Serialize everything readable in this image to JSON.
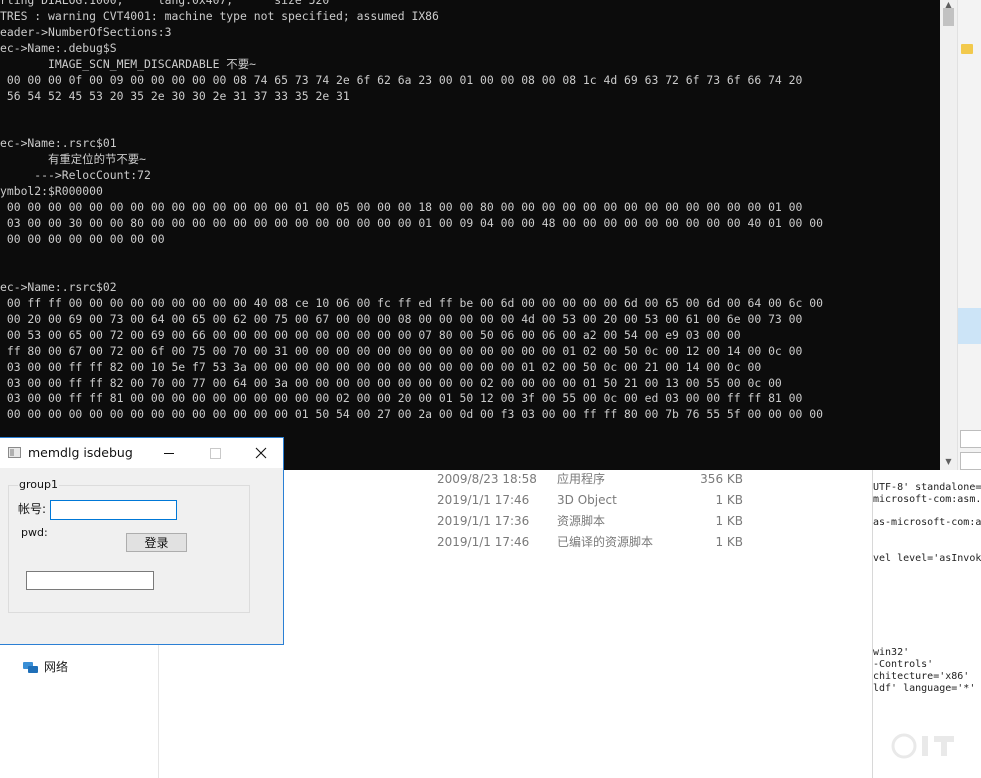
{
  "console": {
    "lines": [
      "rting DIALOG:1000,     lang:0x407,      size 520",
      "TRES : warning CVT4001: machine type not specified; assumed IX86",
      "eader->NumberOfSections:3",
      "ec->Name:.debug$S",
      "       IMAGE_SCN_MEM_DISCARDABLE 不要~",
      " 00 00 00 0f 00 09 00 00 00 00 00 08 74 65 73 74 2e 6f 62 6a 23 00 01 00 00 08 00 08 1c 4d 69 63 72 6f 73 6f 66 74 20",
      " 56 54 52 45 53 20 35 2e 30 30 2e 31 37 33 35 2e 31",
      "",
      "",
      "ec->Name:.rsrc$01",
      "       有重定位的节不要~",
      "     --->RelocCount:72",
      "ymbol2:$R000000",
      " 00 00 00 00 00 00 00 00 00 00 00 00 00 00 01 00 05 00 00 00 18 00 00 80 00 00 00 00 00 00 00 00 00 00 00 00 00 01 00",
      " 03 00 00 30 00 00 80 00 00 00 00 00 00 00 00 00 00 00 00 00 01 00 09 04 00 00 48 00 00 00 00 00 00 00 00 00 40 01 00 00",
      " 00 00 00 00 00 00 00 00",
      "",
      "",
      "ec->Name:.rsrc$02",
      " 00 ff ff 00 00 00 00 00 00 00 00 00 40 08 ce 10 06 00 fc ff ed ff be 00 6d 00 00 00 00 00 6d 00 65 00 6d 00 64 00 6c 00",
      " 00 20 00 69 00 73 00 64 00 65 00 62 00 75 00 67 00 00 00 08 00 00 00 00 00 4d 00 53 00 20 00 53 00 61 00 6e 00 73 00",
      " 00 53 00 65 00 72 00 69 00 66 00 00 00 00 00 00 00 00 00 00 07 80 00 50 06 00 06 00 a2 00 54 00 e9 03 00 00",
      " ff 80 00 67 00 72 00 6f 00 75 00 70 00 31 00 00 00 00 00 00 00 00 00 00 00 00 00 01 02 00 50 0c 00 12 00 14 00 0c 00",
      " 03 00 00 ff ff 82 00 10 5e f7 53 3a 00 00 00 00 00 00 00 00 00 00 00 00 00 01 02 00 50 0c 00 21 00 14 00 0c 00",
      " 03 00 00 ff ff 82 00 70 00 77 00 64 00 3a 00 00 00 00 00 00 00 00 00 02 00 00 00 00 01 50 21 00 13 00 55 00 0c 00",
      " 03 00 00 ff ff 81 00 00 00 00 00 00 00 00 00 00 02 00 00 20 00 01 50 12 00 3f 00 55 00 0c 00 ed 03 00 00 ff ff 81 00",
      " 00 00 00 00 00 00 00 00 00 00 00 00 00 00 01 50 54 00 27 00 2a 00 0d 00 f3 03 00 00 ff ff 80 00 7b 76 55 5f 00 00 00 00"
    ]
  },
  "explorer": {
    "files": [
      {
        "date": "2009/8/23 18:58",
        "type": "应用程序",
        "size": "356 KB"
      },
      {
        "date": "2019/1/1 17:46",
        "type": "3D Object",
        "size": "1 KB"
      },
      {
        "date": "2019/1/1 17:36",
        "type": "资源脚本",
        "size": "1 KB"
      },
      {
        "date": "2019/1/1 17:46",
        "type": "已编译的资源脚本",
        "size": "1 KB"
      }
    ],
    "nav": {
      "network_label": "网络"
    }
  },
  "editor": {
    "lines": [
      "UTF-8' standalone=",
      "microsoft-com:asm.v",
      "",
      "as-microsoft-com:as",
      "",
      "",
      "vel level='asInvoke",
      "",
      "",
      "",
      "",
      "",
      "",
      "",
      "win32'",
      "-Controls'",
      "chitecture='x86'",
      "ldf' language='*' ,"
    ]
  },
  "dialog": {
    "title": "memdlg isdebug",
    "group_label": "group1",
    "account_label": "帐号:",
    "account_value": "",
    "pwd_label": "pwd:",
    "login_label": "登录",
    "bottom_value": ""
  }
}
